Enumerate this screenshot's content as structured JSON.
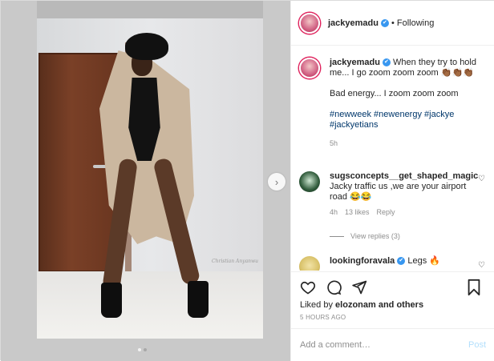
{
  "header": {
    "username": "jackyemadu",
    "verified_icon": "✔",
    "following_label": "• Following"
  },
  "caption": {
    "username": "jackyemadu",
    "line1": "When they try to hold me... I go zoom zoom zoom 👏🏾👏🏾👏🏾",
    "line2": "Bad energy... I zoom zoom zoom",
    "hashtags": "#newweek #newenergy #jackye #jackyetians",
    "time_ago": "5h"
  },
  "comments": [
    {
      "username": "sugsconcepts__get_shaped_magic",
      "text": "Jacky traffic us ,we are your airport road 😂😂",
      "time_ago": "4h",
      "likes": "13 likes",
      "reply_label": "Reply",
      "avatar_color": "#2f5a3a"
    },
    {
      "username": "lookingforavala",
      "text": "Legs 🔥",
      "avatar_color": "#d9c26a"
    }
  ],
  "view_replies_label": "View replies (3)",
  "likes_text_prefix": "Liked by",
  "likes_user": "elozonam",
  "likes_text_suffix": "and others",
  "timestamp": "5 HOURS AGO",
  "add_comment": {
    "placeholder": "Add a comment…",
    "post_label": "Post"
  },
  "photo": {
    "watermark": "Christian Anyanwu"
  },
  "colors": {
    "link": "#00376b",
    "verified": "#3897f0",
    "muted": "#8e8e8e",
    "post_disabled": "#b2dffc"
  },
  "carousel": {
    "slides": 2,
    "active": 1
  },
  "icons": {
    "heart": "heart-icon",
    "comment": "comment-icon",
    "share": "share-icon",
    "bookmark": "bookmark-icon",
    "next": "chevron-right-icon"
  }
}
